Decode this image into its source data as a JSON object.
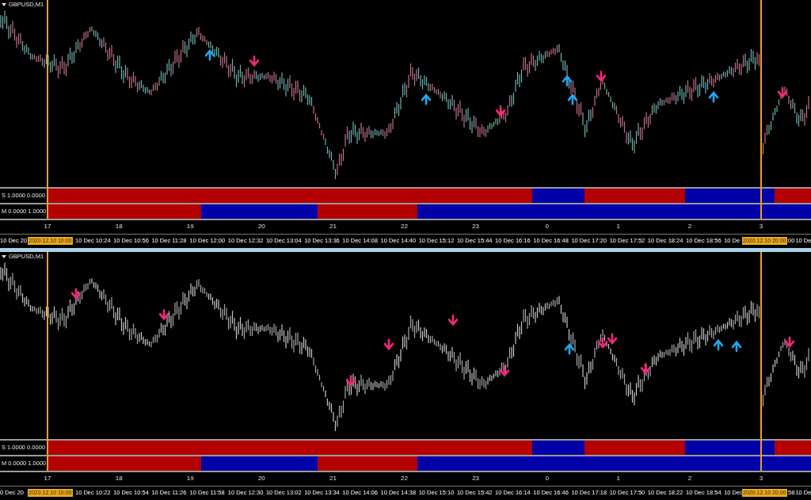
{
  "panes": [
    {
      "title": "GBPUSD,M1",
      "indicators": [
        {
          "label": "S 1.0000 0.0000",
          "segments": [
            {
              "color": "#b40000"
            },
            {
              "color": "#0000a8"
            },
            {
              "color": "#b40000"
            },
            {
              "color": "#0000a8"
            },
            {
              "color": "#b40000"
            }
          ]
        },
        {
          "label": "M 0.0000 1.0000",
          "segments": [
            {
              "color": "#b40000"
            },
            {
              "color": "#0000a8"
            },
            {
              "color": "#b40000"
            },
            {
              "color": "#0000a8"
            }
          ]
        }
      ],
      "hour_labels": [
        "17",
        "18",
        "19",
        "20",
        "21",
        "22",
        "23",
        "0",
        "1",
        "2",
        "3"
      ],
      "time_labels": [
        {
          "kind": "head",
          "text": "10 Dec 20"
        },
        {
          "kind": "full",
          "text": "10 Dec 10:24"
        },
        {
          "kind": "full",
          "text": "10 Dec 10:56"
        },
        {
          "kind": "full",
          "text": "10 Dec 11:28"
        },
        {
          "kind": "full",
          "text": "10 Dec 12:00"
        },
        {
          "kind": "full",
          "text": "10 Dec 12:32"
        },
        {
          "kind": "full",
          "text": "10 Dec 13:04"
        },
        {
          "kind": "full",
          "text": "10 Dec 13:36"
        },
        {
          "kind": "full",
          "text": "10 Dec 14:08"
        },
        {
          "kind": "full",
          "text": "10 Dec 14:40"
        },
        {
          "kind": "full",
          "text": "10 Dec 15:12"
        },
        {
          "kind": "full",
          "text": "10 Dec 15:44"
        },
        {
          "kind": "full",
          "text": "10 Dec 16:16"
        },
        {
          "kind": "full",
          "text": "10 Dec 16:48"
        },
        {
          "kind": "full",
          "text": "10 Dec 17:20"
        },
        {
          "kind": "full",
          "text": "10 Dec 17:52"
        },
        {
          "kind": "full",
          "text": "10 Dec 18:24"
        },
        {
          "kind": "full",
          "text": "10 Dec 18:56"
        },
        {
          "kind": "head",
          "text": "10 De"
        },
        {
          "kind": "tail",
          "text": ":00"
        },
        {
          "kind": "head",
          "text": "10 De"
        }
      ],
      "cursor_labels": [
        "2020.12.10 10:00",
        "2020.12.10 20:00"
      ]
    },
    {
      "title": "GBPUSD,M1",
      "indicators": [
        {
          "label": "S 1.0000 0.0000",
          "segments": [
            {
              "color": "#b40000"
            },
            {
              "color": "#0000a8"
            },
            {
              "color": "#b40000"
            },
            {
              "color": "#0000a8"
            },
            {
              "color": "#b40000"
            }
          ]
        },
        {
          "label": "M 0.0000 1.0000",
          "segments": [
            {
              "color": "#b40000"
            },
            {
              "color": "#0000a8"
            },
            {
              "color": "#b40000"
            },
            {
              "color": "#0000a8"
            }
          ]
        }
      ],
      "hour_labels": [
        "17",
        "18",
        "19",
        "20",
        "21",
        "22",
        "23",
        "0",
        "1",
        "2",
        "3"
      ],
      "time_labels": [
        {
          "kind": "head",
          "text": "0 Dec 20"
        },
        {
          "kind": "full",
          "text": "10 Dec 10:22"
        },
        {
          "kind": "full",
          "text": "10 Dec 10:54"
        },
        {
          "kind": "full",
          "text": "10 Dec 11:26"
        },
        {
          "kind": "full",
          "text": "10 Dec 11:58"
        },
        {
          "kind": "full",
          "text": "10 Dec 12:30"
        },
        {
          "kind": "full",
          "text": "10 Dec 13:02"
        },
        {
          "kind": "full",
          "text": "10 Dec 13:34"
        },
        {
          "kind": "full",
          "text": "10 Dec 14:06"
        },
        {
          "kind": "full",
          "text": "10 Dec 14:38"
        },
        {
          "kind": "full",
          "text": "10 Dec 15:10"
        },
        {
          "kind": "full",
          "text": "10 Dec 15:42"
        },
        {
          "kind": "full",
          "text": "10 Dec 16:14"
        },
        {
          "kind": "full",
          "text": "10 Dec 16:46"
        },
        {
          "kind": "full",
          "text": "10 Dec 17:18"
        },
        {
          "kind": "full",
          "text": "10 Dec 17:50"
        },
        {
          "kind": "full",
          "text": "10 Dec 18:22"
        },
        {
          "kind": "full",
          "text": "10 Dec 18:54"
        },
        {
          "kind": "head",
          "text": "10 Dec"
        },
        {
          "kind": "tail",
          "text": "58"
        },
        {
          "kind": "head",
          "text": "10 De"
        }
      ],
      "cursor_labels": [
        "2020.12.10 10:00",
        "2020.12.10 20:00"
      ]
    }
  ]
}
